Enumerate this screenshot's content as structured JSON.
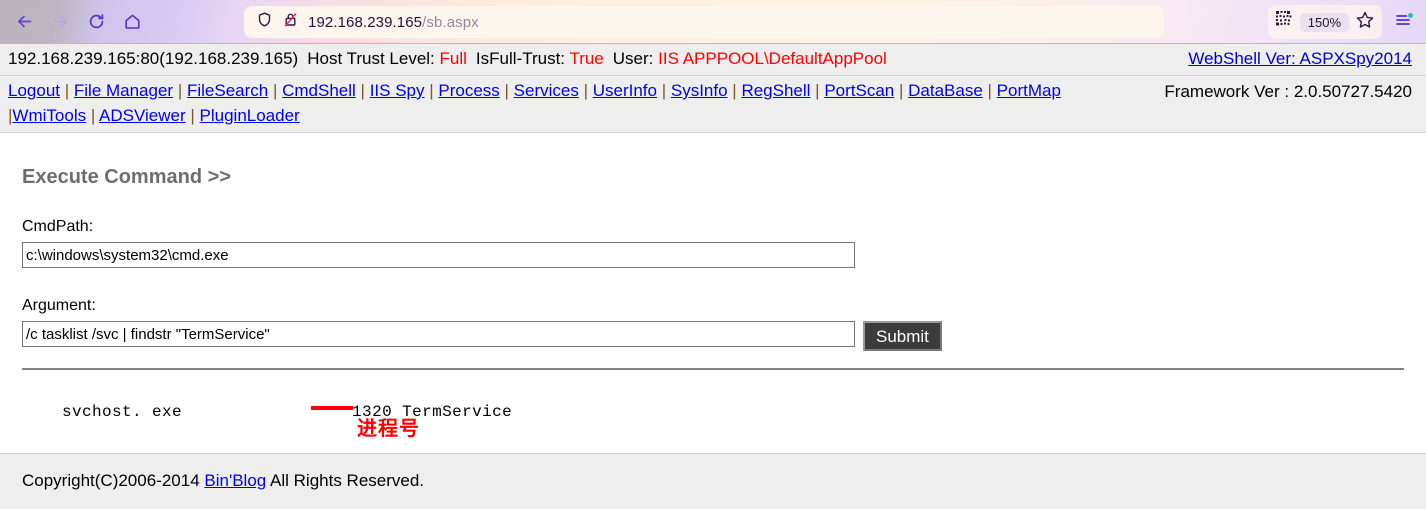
{
  "browser": {
    "back_icon": "back-arrow-icon",
    "forward_icon": "forward-arrow-icon",
    "reload_icon": "reload-icon",
    "home_icon": "home-icon",
    "shield_icon": "shield-icon",
    "insecure_lock_icon": "lock-crossed-icon",
    "url_host": "192.168.239.165",
    "url_path": "/sb.aspx",
    "qr_icon": "qr-code-icon",
    "zoom_level": "150%",
    "bookmark_icon": "star-icon",
    "menu_icon": "hamburger-menu-icon"
  },
  "status": {
    "address": "192.168.239.165:80(192.168.239.165)",
    "host_trust_label": "Host Trust Level:",
    "host_trust_value": "Full",
    "isfulltrust_label": "IsFull-Trust:",
    "isfulltrust_value": "True",
    "user_label": "User:",
    "user_value": "IIS APPPOOL\\DefaultAppPool",
    "webshell_ver": "WebShell Ver: ASPXSpy2014",
    "accent_red": "#ff0000",
    "link_blue": "#0000ee"
  },
  "nav": {
    "links": [
      "Logout",
      "File Manager",
      "FileSearch",
      "CmdShell",
      "IIS Spy",
      "Process",
      "Services",
      "UserInfo",
      "SysInfo",
      "RegShell",
      "PortScan",
      "DataBase",
      "PortMap",
      "WmiTools",
      "ADSViewer",
      "PluginLoader"
    ],
    "separator": "|",
    "framework_ver": "Framework Ver : 2.0.50727.5420"
  },
  "main": {
    "title": "Execute Command >>",
    "cmdpath_label": "CmdPath:",
    "cmdpath_value": "c:\\windows\\system32\\cmd.exe",
    "cmdpath_placeholder": "",
    "argument_label": "Argument:",
    "argument_value": "/c tasklist /svc | findstr \"TermService\"",
    "argument_placeholder": "",
    "submit_label": "Submit",
    "output_text": "svchost. exe                 1320 TermService",
    "annotation_text": "进程号",
    "annotation_color": "#ff0000"
  },
  "footer": {
    "copyright_prefix": "Copyright(C)2006-2014 ",
    "link_label": "Bin'Blog",
    "copyright_suffix": " All Rights Reserved."
  }
}
